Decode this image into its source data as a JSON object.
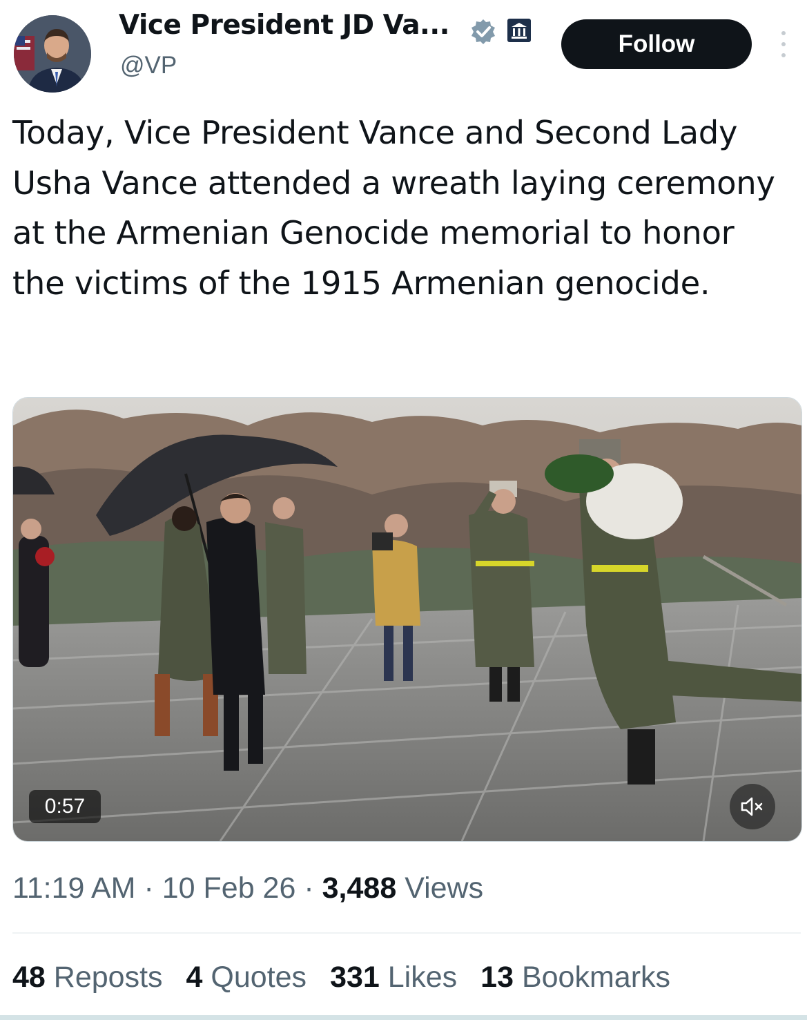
{
  "author": {
    "display_name": "Vice President JD Va...",
    "handle": "@VP"
  },
  "follow_label": "Follow",
  "tweet": {
    "text": "Today, Vice President Vance and Second Lady Usha Vance attended a wreath laying ceremony at the Armenian Genocide memorial to honor the victims of the 1915 Armenian genocide."
  },
  "video": {
    "duration": "0:57",
    "muted": true
  },
  "meta": {
    "time": "11:19 AM",
    "date": "10 Feb 26",
    "views_count": "3,488",
    "views_label": "Views",
    "separator": "·"
  },
  "stats": {
    "reposts_count": "48",
    "reposts_label": "Reposts",
    "quotes_count": "4",
    "quotes_label": "Quotes",
    "likes_count": "331",
    "likes_label": "Likes",
    "bookmarks_count": "13",
    "bookmarks_label": "Bookmarks"
  },
  "icons": {
    "verified": "verified-badge-icon",
    "affiliation": "government-building-icon",
    "more": "more-vertical-icon",
    "mute": "speaker-muted-icon"
  },
  "colors": {
    "text": "#0f1419",
    "secondary_text": "#536471",
    "follow_bg": "#0f1419",
    "verified_gray": "#829aab"
  }
}
